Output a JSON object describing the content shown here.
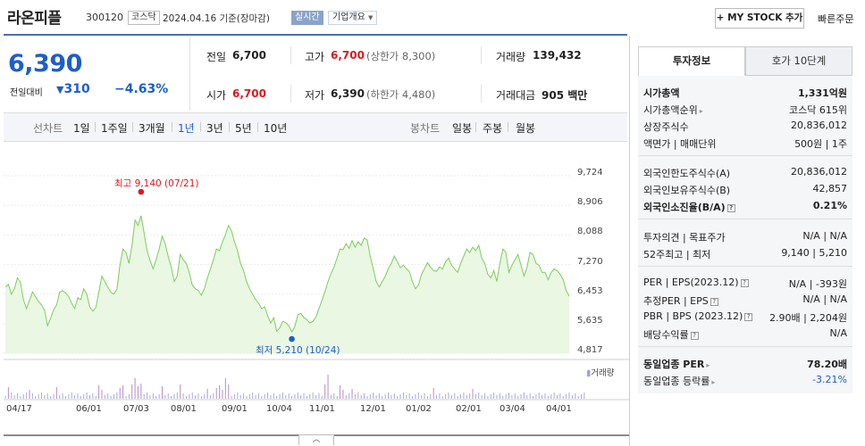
{
  "header": {
    "name": "라온피플",
    "code": "300120",
    "market": "코스닥",
    "date_label": "2024.04.16  기준(장마감)",
    "live_label": "실시간",
    "company_btn": "기업개요",
    "mystock_btn": "+ MY STOCK 추가",
    "quick_order": "빠른주문"
  },
  "summary": {
    "price": "6,390",
    "change_label": "전일대비",
    "change_value": "310",
    "change_pct": "−4.63%",
    "prev_close": {
      "label": "전일",
      "value": "6,700"
    },
    "high": {
      "label": "고가",
      "value": "6,700",
      "sub": "(상한가 8,300)"
    },
    "volume": {
      "label": "거래량",
      "value": "139,432"
    },
    "open": {
      "label": "시가",
      "value": "6,700"
    },
    "low": {
      "label": "저가",
      "value": "6,390",
      "sub": "(하한가 4,480)"
    },
    "amount": {
      "label": "거래대금",
      "value": "905 백만"
    }
  },
  "period": {
    "line_label": "선차트",
    "line_items": [
      "1일",
      "1주일",
      "3개월",
      "1년",
      "3년",
      "5년",
      "10년"
    ],
    "active": "1년",
    "candle_label": "봉차트",
    "candle_items": [
      "일봉",
      "주봉",
      "월봉"
    ]
  },
  "chart_data": {
    "type": "area",
    "ylim": [
      4817,
      9724
    ],
    "yticks": [
      "9,724",
      "8,906",
      "8,088",
      "7,270",
      "6,453",
      "5,635",
      "4,817"
    ],
    "xticks": [
      "04/17",
      "06/01",
      "07/03",
      "08/01",
      "09/01",
      "10/04",
      "11/01",
      "12/01",
      "01/02",
      "02/01",
      "03/04",
      "04/01"
    ],
    "high_label": "최고 9,140 (07/21)",
    "low_label": "최저 5,210 (10/24)",
    "volume_label": "거래량",
    "colors": {
      "line": "#7ccd5a",
      "fill": "#eaf7e3",
      "high": "#e0161c",
      "low": "#1e5ec8"
    },
    "prices": [
      6650,
      6720,
      6450,
      6600,
      6900,
      6780,
      6300,
      6050,
      6280,
      6510,
      6380,
      6250,
      6150,
      6000,
      5580,
      5780,
      6020,
      6150,
      6500,
      6550,
      6480,
      6380,
      6200,
      6050,
      6350,
      6300,
      6600,
      6450,
      6100,
      5980,
      6080,
      6500,
      6950,
      6800,
      6650,
      6500,
      6450,
      6600,
      7250,
      7700,
      7600,
      7300,
      7800,
      8500,
      8350,
      8620,
      8150,
      7650,
      7380,
      7150,
      7400,
      7700,
      8050,
      7850,
      7500,
      7200,
      6800,
      6950,
      7550,
      7400,
      7300,
      7050,
      6700,
      6600,
      6550,
      6420,
      6600,
      6900,
      7150,
      7400,
      7700,
      7650,
      7900,
      8100,
      8350,
      8200,
      7900,
      7650,
      7300,
      7100,
      6800,
      6600,
      6450,
      6300,
      6200,
      6050,
      6100,
      5850,
      5650,
      5800,
      5420,
      5520,
      5700,
      5660,
      5580,
      5410,
      5550,
      5880,
      5920,
      5800,
      5750,
      5650,
      5700,
      5820,
      6050,
      6280,
      6520,
      6800,
      7020,
      7200,
      7450,
      7700,
      7680,
      7850,
      7720,
      7930,
      7750,
      7900,
      7800,
      8000,
      7950,
      7500,
      7150,
      6800,
      6650,
      6800,
      6950,
      7150,
      7300,
      7500,
      7350,
      7180,
      7250,
      7150,
      7070,
      6800,
      6600,
      6700,
      7000,
      7150,
      7320,
      7200,
      7100,
      7080,
      7200,
      7150,
      7350,
      7450,
      7250,
      7150,
      7050,
      7300,
      7500,
      7700,
      7600,
      7750,
      7650,
      7800,
      7450,
      7300,
      7000,
      6900,
      7100,
      6800,
      7300,
      7700,
      7600,
      7050,
      7250,
      7400,
      7550,
      7250,
      6950,
      7200,
      7600,
      7550,
      7300,
      7250,
      7050,
      7050,
      6850,
      7050,
      7150,
      7100,
      7000,
      6850,
      6550,
      6390
    ],
    "volumes": [
      1,
      2,
      1,
      1,
      1,
      1,
      1,
      1,
      2,
      1,
      1,
      1,
      1,
      1,
      1,
      1,
      1,
      2,
      1,
      1,
      1,
      1,
      1,
      1,
      1,
      1,
      1,
      1,
      1,
      1,
      1,
      2,
      2,
      1,
      1,
      1,
      1,
      1,
      2,
      2,
      1,
      1,
      2,
      3,
      2,
      2,
      1,
      1,
      1,
      1,
      1,
      1,
      2,
      1,
      1,
      1,
      1,
      1,
      2,
      1,
      1,
      1,
      1,
      1,
      1,
      1,
      1,
      2,
      1,
      1,
      2,
      2,
      2,
      3,
      2,
      1,
      1,
      1,
      1,
      1,
      1,
      1,
      1,
      1,
      1,
      1,
      1,
      1,
      1,
      1,
      1,
      1,
      1,
      1,
      1,
      1,
      1,
      1,
      1,
      1,
      1,
      1,
      1,
      1,
      1,
      1,
      2,
      3,
      1,
      1,
      1,
      2,
      2,
      1,
      1,
      2,
      1,
      1,
      1,
      1,
      1,
      1,
      1,
      1,
      1,
      1,
      1,
      1,
      1,
      1,
      1,
      1,
      1,
      1,
      1,
      1,
      1,
      1,
      1,
      1,
      1,
      1,
      2,
      1,
      1,
      1,
      1,
      1,
      1,
      1,
      1,
      1,
      1,
      1,
      1,
      2,
      1,
      1,
      1,
      1,
      1,
      1,
      1,
      1,
      1,
      1,
      1,
      1,
      1,
      1,
      1,
      1,
      1,
      1,
      1,
      1,
      1,
      1,
      1,
      1,
      1,
      1,
      1,
      1,
      1,
      1,
      1,
      1,
      1,
      1,
      1,
      1,
      1
    ]
  },
  "right_panel": {
    "tab_active": "투자정보",
    "tab_other": "호가 10단계",
    "group1": [
      {
        "l": "시가총액",
        "r": "1,331억원",
        "bold": true
      },
      {
        "l": "시가총액순위",
        "r": "코스닥 615위",
        "arrow": true
      },
      {
        "l": "상장주식수",
        "r": "20,836,012"
      },
      {
        "l": "액면가 | 매매단위",
        "r": "500원  |  1주"
      }
    ],
    "group2": [
      {
        "l": "외국인한도주식수(A)",
        "r": "20,836,012"
      },
      {
        "l": "외국인보유주식수(B)",
        "r": "42,857"
      },
      {
        "l": "외국인소진율(B/A)",
        "r": "0.21%",
        "bold": true,
        "hint": true
      }
    ],
    "group3": [
      {
        "l": "투자의견 | 목표주가",
        "r": "N/A  |  N/A"
      },
      {
        "l": "52주최고 | 최저",
        "r": "9,140  |  5,210"
      }
    ],
    "group4": [
      {
        "l": "PER | EPS(2023.12)",
        "r": "N/A  |  -393원",
        "hint": true
      },
      {
        "l": "추정PER | EPS",
        "r": "N/A  |  N/A",
        "hint": true
      },
      {
        "l": "PBR | BPS (2023.12)",
        "r": "2.90배  |  2,204원",
        "hint": true
      },
      {
        "l": "배당수익률",
        "r": "N/A",
        "hint": true
      }
    ],
    "group5": [
      {
        "l": "동일업종 PER",
        "r": "78.20배",
        "bold": true,
        "arrow": true
      },
      {
        "l": "동일업종 등락률",
        "r": "-3.21%",
        "arrow": true,
        "blue": true
      }
    ]
  }
}
